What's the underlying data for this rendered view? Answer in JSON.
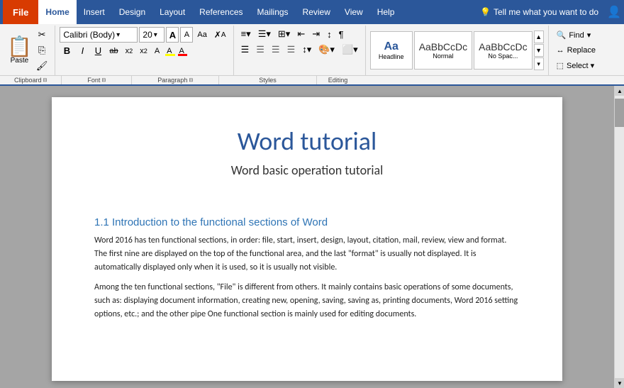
{
  "menubar": {
    "file": "File",
    "home": "Home",
    "insert": "Insert",
    "design": "Design",
    "layout": "Layout",
    "references": "References",
    "mailings": "Mailings",
    "review": "Review",
    "view": "View",
    "help": "Help",
    "tell_me": "Tell me what you want to do",
    "tell_me_icon": "💡"
  },
  "toolbar": {
    "clipboard": {
      "label": "Clipboard",
      "paste": "Paste",
      "cut": "✂",
      "copy": "⎘",
      "format_painter": "🖌"
    },
    "font": {
      "label": "Font",
      "name": "Calibri (Body)",
      "size": "20",
      "grow": "A",
      "shrink": "A",
      "change_case": "Aa",
      "clear_format": "🧹",
      "bold": "B",
      "italic": "I",
      "underline": "U",
      "strikethrough": "ab",
      "subscript": "x₂",
      "superscript": "x²",
      "text_color": "A",
      "highlight": "A"
    },
    "paragraph": {
      "label": "Paragraph",
      "bullets": "≡",
      "numbering": "☰",
      "multi_list": "⊞",
      "outdent": "⇤",
      "indent": "⇥",
      "sort": "↕",
      "show_para": "¶",
      "align_left": "≡",
      "align_center": "≡",
      "align_right": "≡",
      "justify": "≡",
      "line_spacing": "↕",
      "shading": "🎨",
      "borders": "⬜"
    },
    "styles": {
      "label": "Styles",
      "headline": "Headline",
      "normal": "Normal",
      "no_spacing": "No Spac..."
    },
    "editing": {
      "label": "Editing",
      "find": "Find",
      "replace": "Replace",
      "select": "Select ▾"
    }
  },
  "document": {
    "title": "Word tutorial",
    "subtitle": "Word basic operation tutorial",
    "section1_heading": "1.1 Introduction to the functional sections of Word",
    "para1": "Word 2016 has ten functional sections, in order: file, start, insert, design, layout, citation, mail, review, view and format. The first nine are displayed on the top of the functional area, and the last \"format\" is usually not displayed. It is automatically displayed only when it is used, so it is usually not visible.",
    "para2": "Among the ten functional sections, \"File\" is different from others. It mainly contains basic operations of some documents, such as: displaying document information, creating new, opening, saving, saving as, printing documents, Word 2016 setting options, etc.; and the other pipe One functional section is mainly used for editing documents."
  },
  "groups_labels": {
    "clipboard": "Clipboard",
    "font": "Font",
    "paragraph": "Paragraph",
    "styles": "Styles",
    "editing": "Editing"
  },
  "colors": {
    "accent": "#2b579a",
    "file_btn": "#d83b01",
    "text_color_red": "#ff0000",
    "highlight_yellow": "#ffff00"
  }
}
